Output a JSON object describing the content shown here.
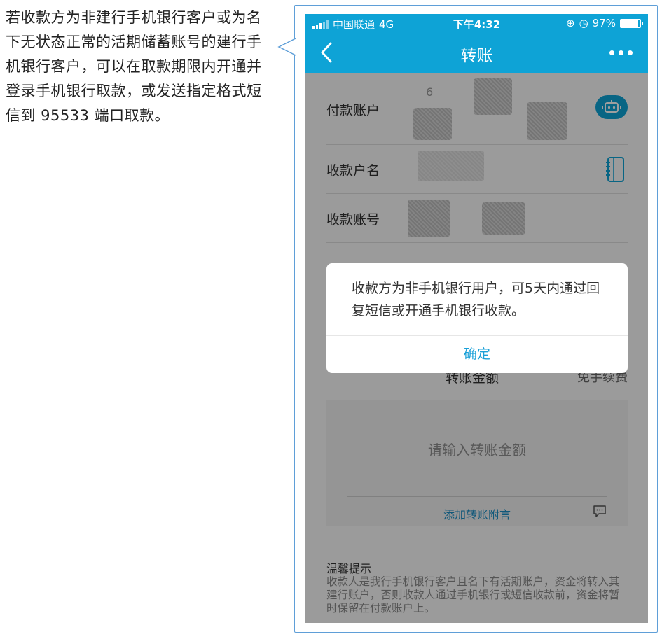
{
  "annotation": {
    "text": "若收款方为非建行手机银行客户或为名下无状态正常的活期储蓄账号的建行手机银行客户，可以在取款期限内开通并登录手机银行取款，或发送指定格式短信到 95533 端口取款。"
  },
  "status_bar": {
    "carrier": "中国联通",
    "network": "4G",
    "time": "下午4:32",
    "battery": "97%",
    "battery_level": 0.97
  },
  "nav": {
    "title": "转账",
    "back_icon": "chevron-left-icon",
    "more_icon": "more-dots-icon"
  },
  "form": {
    "payer_label": "付款账户",
    "payer_partial": "6",
    "payee_name_label": "收款户名",
    "payee_account_label": "收款账号",
    "robot_icon": "robot-icon",
    "contacts_icon": "address-book-icon"
  },
  "amount": {
    "label": "转账金额",
    "fee_note": "免手续费",
    "placeholder": "请输入转账金额",
    "memo_link": "添加转账附言",
    "memo_icon": "message-icon"
  },
  "tips": {
    "title": "温馨提示",
    "text": "收款人是我行手机银行客户且名下有活期账户，资金将转入其建行账户，否则收款人通过手机银行或短信收款前，资金将暂时保留在付款账户上。"
  },
  "dialog": {
    "message": "收款方为非手机银行用户，可5天内通过回复短信或开通手机银行收款。",
    "ok_label": "确定"
  },
  "colors": {
    "brand_blue": "#0ea3d6",
    "link_blue": "#1aa0d8",
    "callout_border": "#5f9fd8"
  }
}
